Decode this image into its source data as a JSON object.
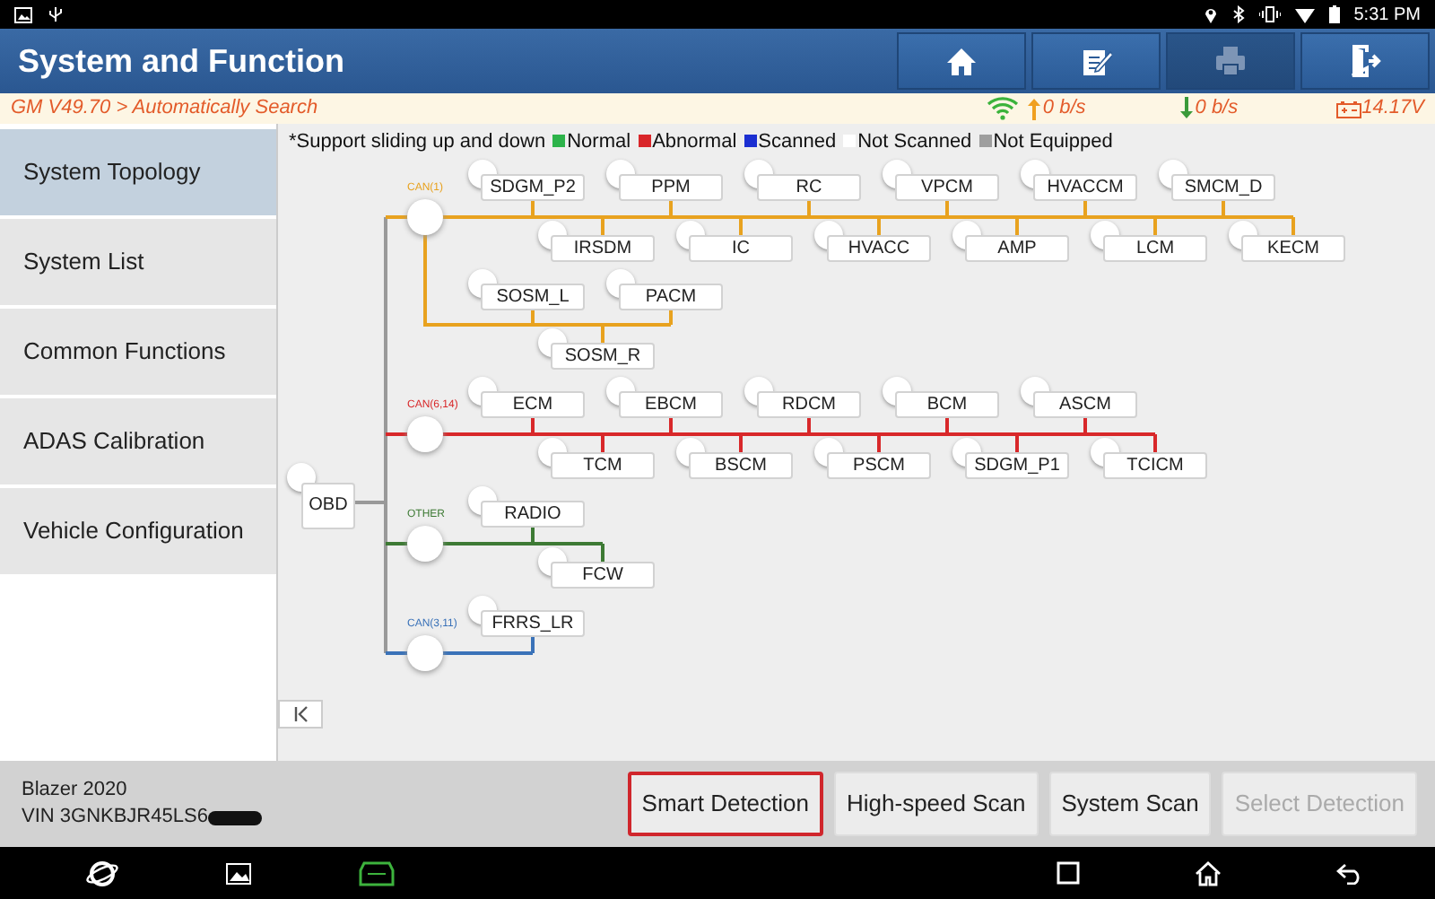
{
  "status_bar": {
    "time": "5:31 PM"
  },
  "header": {
    "title": "System and Function",
    "buttons": [
      {
        "kind": "home",
        "disabled": false
      },
      {
        "kind": "edit",
        "disabled": false
      },
      {
        "kind": "print",
        "disabled": true
      },
      {
        "kind": "exit",
        "disabled": false
      }
    ]
  },
  "info_bar": {
    "path": "GM V49.70 > Automatically Search",
    "upload": "0 b/s",
    "download": "0 b/s",
    "voltage": "14.17V"
  },
  "sidebar": {
    "items": [
      {
        "label": "System Topology",
        "selected": true
      },
      {
        "label": "System List",
        "selected": false
      },
      {
        "label": "Common Functions",
        "selected": false
      },
      {
        "label": "ADAS Calibration",
        "selected": false
      },
      {
        "label": "Vehicle Configuration",
        "selected": false
      }
    ]
  },
  "legend": {
    "note": "*Support sliding up and down",
    "items": [
      {
        "label": "Normal",
        "color": "#2db34a"
      },
      {
        "label": "Abnormal",
        "color": "#d9262a"
      },
      {
        "label": "Scanned",
        "color": "#1b2fd1"
      },
      {
        "label": "Not Scanned",
        "color": "#ffffff"
      },
      {
        "label": "Not Equipped",
        "color": "#9e9e9e"
      }
    ]
  },
  "topology": {
    "root": "OBD",
    "buses": [
      {
        "label": "CAN(1)",
        "color": "#e8a21f",
        "groups": [
          {
            "top": [
              "SDGM_P2",
              "PPM",
              "RC",
              "VPCM",
              "HVACCM",
              "SMCM_D"
            ],
            "bottom": [
              "IRSDM",
              "IC",
              "HVACC",
              "AMP",
              "LCM",
              "KECM"
            ]
          },
          {
            "top": [
              "SOSM_L",
              "PACM"
            ],
            "bottom": [
              "SOSM_R"
            ]
          }
        ]
      },
      {
        "label": "CAN(6,14)",
        "color": "#d8282a",
        "groups": [
          {
            "top": [
              "ECM",
              "EBCM",
              "RDCM",
              "BCM",
              "ASCM"
            ],
            "bottom": [
              "TCM",
              "BSCM",
              "PSCM",
              "SDGM_P1",
              "TCICM"
            ]
          }
        ]
      },
      {
        "label": "OTHER",
        "color": "#3d7a34",
        "groups": [
          {
            "top": [
              "RADIO"
            ],
            "bottom": [
              "FCW"
            ]
          }
        ]
      },
      {
        "label": "CAN(3,11)",
        "color": "#3a72b8",
        "groups": [
          {
            "top": [
              "FRRS_LR"
            ]
          }
        ]
      }
    ]
  },
  "vehicle": {
    "model": "Blazer 2020",
    "vin": "VIN 3GNKBJR45LS6"
  },
  "actions": [
    {
      "label": "Smart Detection",
      "selected": true,
      "disabled": false
    },
    {
      "label": "High-speed Scan",
      "selected": false,
      "disabled": false
    },
    {
      "label": "System Scan",
      "selected": false,
      "disabled": false
    },
    {
      "label": "Select Detection",
      "selected": false,
      "disabled": true
    }
  ]
}
